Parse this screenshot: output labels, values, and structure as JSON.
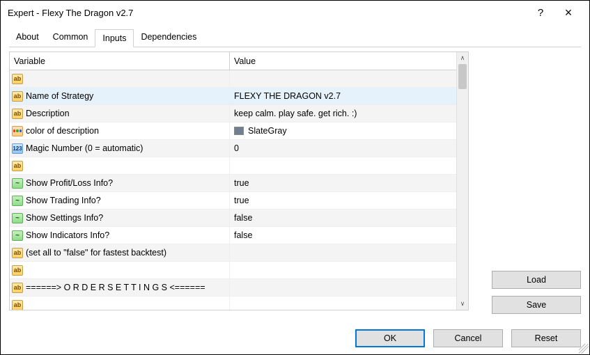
{
  "titlebar": {
    "title": "Expert - Flexy The Dragon v2.7",
    "help": "?",
    "close": "×"
  },
  "tabs": [
    "About",
    "Common",
    "Inputs",
    "Dependencies"
  ],
  "activeTab": 2,
  "columns": {
    "variable": "Variable",
    "value": "Value"
  },
  "rows": [
    {
      "icon": "ab",
      "var": ".",
      "val": ""
    },
    {
      "icon": "ab",
      "var": "Name of Strategy",
      "val": "FLEXY THE DRAGON v2.7",
      "sel": true
    },
    {
      "icon": "ab",
      "var": "Description",
      "val": "keep calm. play safe. get rich. :)"
    },
    {
      "icon": "pal",
      "var": "color of description",
      "valColor": "SlateGray"
    },
    {
      "icon": "num",
      "var": "Magic Number (0 = automatic)",
      "val": "0"
    },
    {
      "icon": "ab",
      "var": ".",
      "val": ""
    },
    {
      "icon": "bool",
      "var": "Show Profit/Loss Info?",
      "val": "true"
    },
    {
      "icon": "bool",
      "var": "Show Trading Info?",
      "val": "true"
    },
    {
      "icon": "bool",
      "var": "Show Settings Info?",
      "val": "false"
    },
    {
      "icon": "bool",
      "var": "Show Indicators Info?",
      "val": "false"
    },
    {
      "icon": "ab",
      "var": "(set all to \"false\" for fastest backtest)",
      "val": ""
    },
    {
      "icon": "ab",
      "var": ".",
      "val": ""
    },
    {
      "icon": "ab",
      "var": "======>  O R D E R   S E T T I N G S  <======",
      "val": ""
    },
    {
      "icon": "ab",
      "var": ".",
      "val": ""
    }
  ],
  "buttons": {
    "load": "Load",
    "save": "Save",
    "ok": "OK",
    "cancel": "Cancel",
    "reset": "Reset"
  },
  "iconText": {
    "ab": "ab",
    "num": "123"
  }
}
